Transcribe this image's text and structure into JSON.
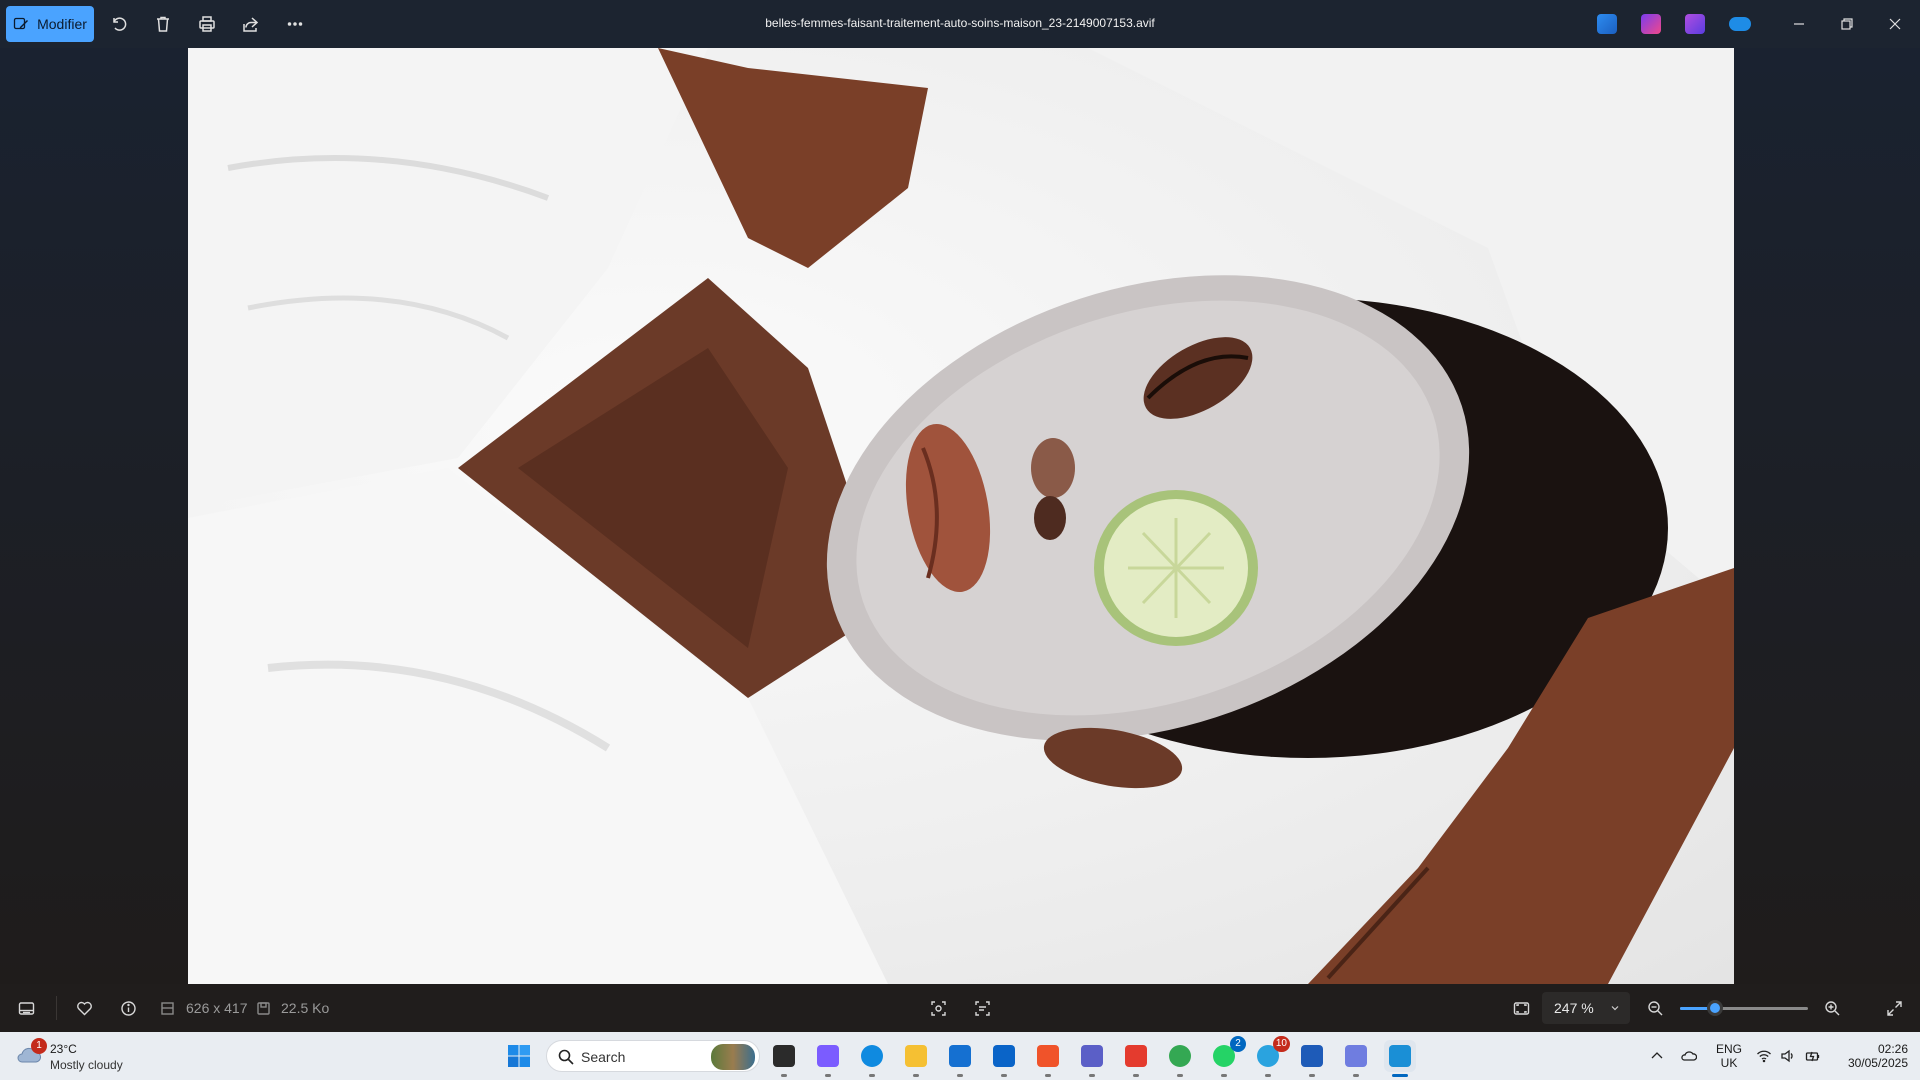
{
  "titlebar": {
    "edit_label": "Modifier",
    "filename": "belles-femmes-faisant-traitement-auto-soins-maison_23-2149007153.avif",
    "icons": [
      "rotate-icon",
      "delete-icon",
      "print-icon",
      "share-icon",
      "more-icon"
    ],
    "app_icons": [
      "photos-editor-icon",
      "clipchamp-icon",
      "video-editor-icon",
      "onedrive-icon"
    ],
    "window_controls": [
      "minimize-icon",
      "restore-icon",
      "close-icon"
    ]
  },
  "image": {
    "description_alt": "photo"
  },
  "statusbar": {
    "dimensions": "626 x 417",
    "file_size": "22.5 Ko",
    "zoom_value": "247 %",
    "zoom_level": 0.27
  },
  "taskbar": {
    "weather": {
      "temp": "23°C",
      "condition": "Mostly cloudy",
      "badge": "1"
    },
    "search_placeholder": "Search",
    "apps": [
      {
        "name": "task-view",
        "color": "#2b2b2b"
      },
      {
        "name": "copilot",
        "color": "#7b5cff"
      },
      {
        "name": "edge",
        "color": "#0f8ae0"
      },
      {
        "name": "file-explorer",
        "color": "#f5c033"
      },
      {
        "name": "microsoft-store",
        "color": "#1570d1"
      },
      {
        "name": "outlook",
        "color": "#0a64c8"
      },
      {
        "name": "brave",
        "color": "#f0532a"
      },
      {
        "name": "teams",
        "color": "#5b5fc7"
      },
      {
        "name": "wps-office",
        "color": "#e43b2e"
      },
      {
        "name": "chrome",
        "color": "#34a853"
      },
      {
        "name": "whatsapp",
        "color": "#25d366",
        "badge": "2",
        "badge_color": "#0067c0"
      },
      {
        "name": "telegram",
        "color": "#2aa3df",
        "badge": "10",
        "badge_color": "#c42b1c"
      },
      {
        "name": "word",
        "color": "#1e5bb8"
      },
      {
        "name": "affinity",
        "color": "#6f7de0"
      },
      {
        "name": "photos",
        "color": "#1a8fd6",
        "active": true
      }
    ],
    "tray": {
      "lang_top": "ENG",
      "lang_bottom": "UK",
      "time": "02:26",
      "date": "30/05/2025"
    }
  }
}
